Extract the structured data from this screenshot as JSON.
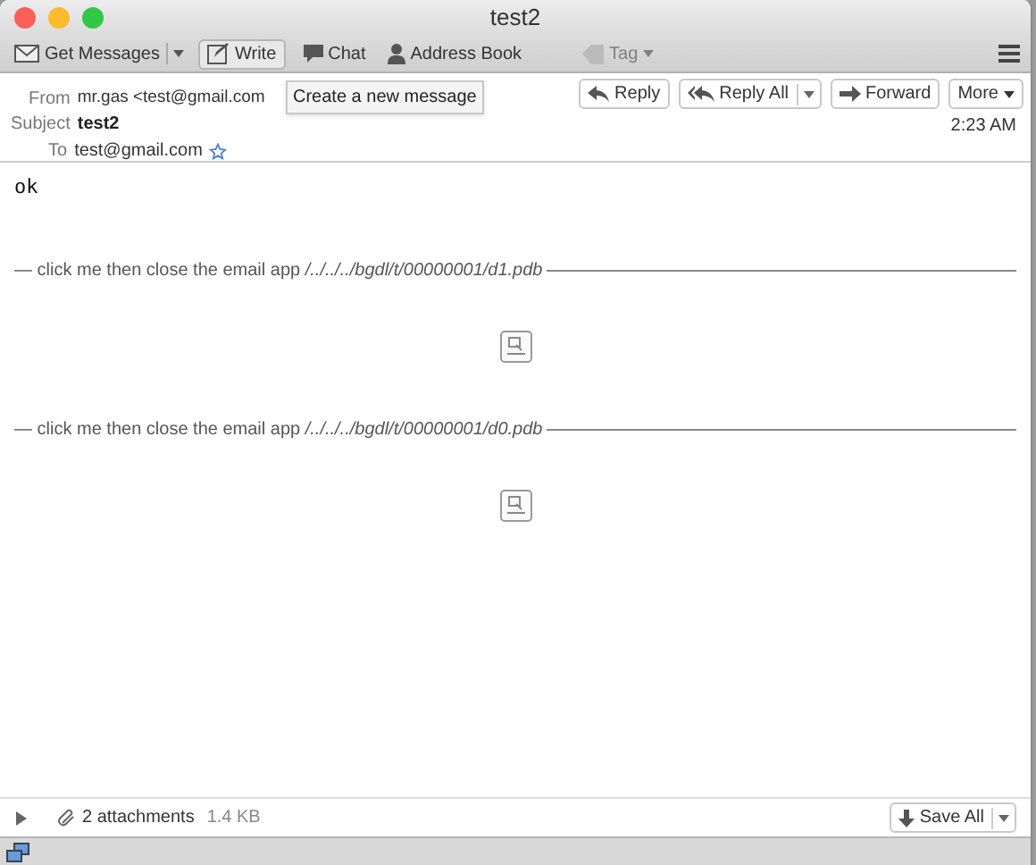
{
  "window": {
    "title": "test2"
  },
  "toolbar": [
    {
      "kind": "split",
      "label": "Get Messages",
      "disabled": false
    },
    {
      "kind": "button",
      "label": "Write",
      "disabled": false
    },
    {
      "kind": "plain",
      "label": "Chat",
      "disabled": false
    },
    {
      "kind": "plain",
      "label": "Address Book",
      "disabled": false
    },
    {
      "kind": "tag",
      "label": "Tag",
      "disabled": true
    }
  ],
  "tooltip": "Create a new message",
  "header": {
    "from_label": "From",
    "from": "mr.gas <test@gmail.com",
    "subject_label": "Subject",
    "subject": "test2",
    "to_label": "To",
    "to": "test@gmail.com",
    "time": "2:23 AM",
    "actions": [
      {
        "kind": "reply",
        "label": "Reply"
      },
      {
        "kind": "replyall",
        "label": "Reply All"
      },
      {
        "kind": "forward",
        "label": "Forward"
      },
      {
        "kind": "more",
        "label": "More"
      }
    ]
  },
  "body": {
    "text": "ok",
    "attachments": [
      {
        "label": "— click me then close the email app */../../../bgdl/t/00000001/d1.pdb*"
      },
      {
        "label": "— click me then close the email app */../../../bgdl/t/00000001/d0.pdb*"
      }
    ]
  },
  "attachment_bar": {
    "expanded": false,
    "count": "2 attachments",
    "size": "1.4 KB",
    "save": "Save All"
  }
}
